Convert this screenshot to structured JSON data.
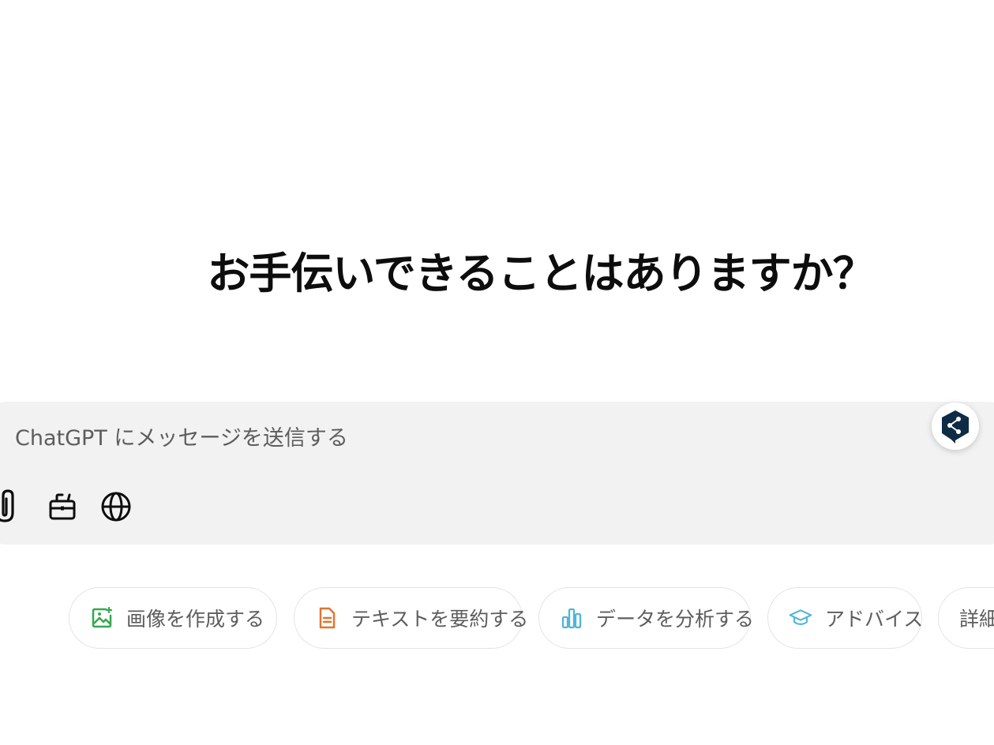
{
  "headline": "お手伝いできることはありますか？",
  "composer": {
    "placeholder": "ChatGPT にメッセージを送信する"
  },
  "tools": {
    "attach_icon": "paperclip-icon",
    "tools_icon": "toolbox-icon",
    "search_icon": "globe-icon"
  },
  "extension_icon": "deepl-share-icon",
  "suggestions": [
    {
      "label": "画像を作成する",
      "icon": "image-icon",
      "color": "#35a84f"
    },
    {
      "label": "テキストを要約する",
      "icon": "document-icon",
      "color": "#e2742f"
    },
    {
      "label": "データを分析する",
      "icon": "bar-chart-icon",
      "color": "#4fb5d8"
    },
    {
      "label": "アドバイス",
      "icon": "graduation-cap-icon",
      "color": "#4fb5d8"
    },
    {
      "label": "詳細",
      "icon": "",
      "color": ""
    }
  ]
}
